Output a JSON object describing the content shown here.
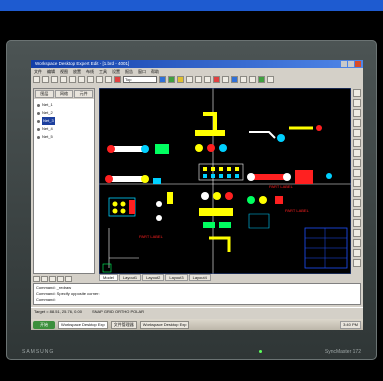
{
  "window": {
    "title": "Workspace Desktop Expert Edit - [1.brd - 4001]"
  },
  "menubar": [
    "文件",
    "编辑",
    "视图",
    "放置",
    "布线",
    "工具",
    "设置",
    "报告",
    "窗口",
    "帮助"
  ],
  "toolbar": {
    "layer_value": "Top"
  },
  "left_panel": {
    "tabs": [
      "图层",
      "网络",
      "元件"
    ],
    "tree_items": [
      {
        "label": "Net_1"
      },
      {
        "label": "Net_2"
      },
      {
        "label": "Net_3"
      },
      {
        "label": "Net_4"
      },
      {
        "label": "Net_5"
      }
    ],
    "selected_index": 2
  },
  "canvas": {
    "background": "#000000",
    "trace_colors": [
      "#ffff00",
      "#ff2020",
      "#00d0ff",
      "#ffffff",
      "#00ff60"
    ],
    "labels": [
      "PART LABEL",
      "PART LABEL",
      "PART LABEL"
    ]
  },
  "layout_tabs": [
    "Model",
    "Layout1",
    "Layout2",
    "Layout3",
    "Layout4"
  ],
  "command_lines": [
    "Command: _redraw",
    "Command: Specify opposite corner:",
    "Command:"
  ],
  "status": {
    "coords": "Target = 88.51, 25.76, 0.00",
    "mode": "SNAP GRID ORTHO POLAR"
  },
  "taskbar": {
    "start_label": "开始",
    "tasks": [
      "Workspace Desktop Exp",
      "文件管理器",
      "Workspace Desktop Exp"
    ],
    "tray_time": "3:40 PM"
  },
  "monitor": {
    "brand_left": "SAMSUNG",
    "brand_right": "SyncMaster 172"
  }
}
